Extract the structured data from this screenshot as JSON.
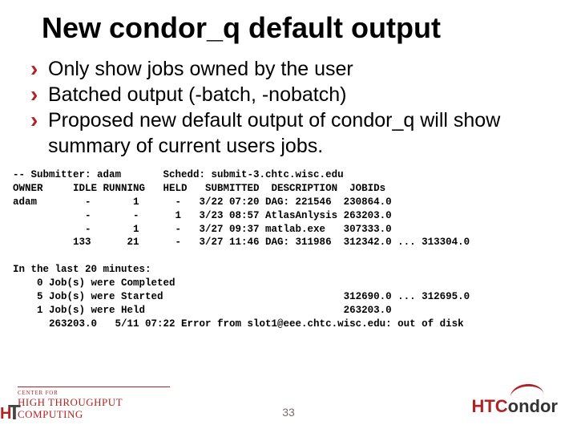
{
  "title": "New condor_q default output",
  "bullets": [
    "Only show jobs owned by the user",
    "Batched output (-batch, -nobatch)",
    "Proposed new default output of condor_q will show summary of current users jobs."
  ],
  "terminal": {
    "header_line": "-- Submitter: adam       Schedd: submit-3.chtc.wisc.edu",
    "columns_line": "OWNER     IDLE RUNNING   HELD   SUBMITTED  DESCRIPTION  JOBIDs",
    "rows": [
      "adam        -       1      -   3/22 07:20 DAG: 221546  230864.0",
      "            -       -      1   3/23 08:57 AtlasAnlysis 263203.0",
      "            -       1      -   3/27 09:37 matlab.exe   307333.0",
      "          133      21      -   3/27 11:46 DAG: 311986  312342.0 ... 313304.0"
    ],
    "summary_header": "In the last 20 minutes:",
    "summary_lines": [
      "    0 Job(s) were Completed",
      "    5 Job(s) were Started                              312690.0 ... 312695.0",
      "    1 Job(s) were Held                                 263203.0",
      "      263203.0   5/11 07:22 Error from slot1@eee.chtc.wisc.edu: out of disk"
    ]
  },
  "page_number": "33",
  "logos": {
    "left_center": "CENTER FOR",
    "left_line1": "HIGH THROUGHPUT",
    "left_line2": "COMPUTING",
    "right_ht": "HTC",
    "right_rest": "ondor"
  }
}
